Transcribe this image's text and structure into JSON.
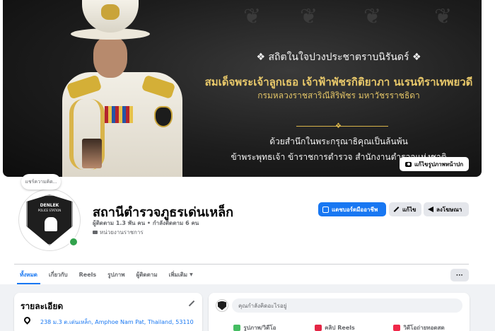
{
  "cover": {
    "line1": "❖ สถิตในใจปวงประชาตราบนิรันดร์ ❖",
    "line2": "สมเด็จพระเจ้าลูกเธอ เจ้าฟ้าพัชรกิติยาภา นเรนทิราเทพยวดี",
    "line3": "กรมหลวงราชสาริณีสิริพัชร มหาวัชรราชธิดา",
    "line4": "ด้วยสำนึกในพระกรุณาธิคุณเป็นล้นพ้น",
    "line5": "ข้าพระพุทธเจ้า ข้าราชการตำรวจ สำนักงานตำรวจแห่งชาติ",
    "edit_cover_label": "แก้ไขรูปภาพหน้าปก"
  },
  "profile": {
    "note_placeholder": "แชร์ความคิด...",
    "logo_title": "DENLEK",
    "logo_subtitle": "POLICE STATION",
    "name": "สถานีตำรวจภูธรเด่นเหล็ก",
    "followers": "ผู้ติดตาม 1.3 พัน คน • กำลังติดตาม 6 คน",
    "category": "หน่วยงานราชการ"
  },
  "actions": {
    "dashboard": "แดชบอร์ดมืออาชีพ",
    "edit": "แก้ไข",
    "advertise": "ลงโฆษณา",
    "more": "···"
  },
  "tabs": [
    {
      "label": "ทั้งหมด",
      "active": true
    },
    {
      "label": "เกี่ยวกับ",
      "active": false
    },
    {
      "label": "Reels",
      "active": false
    },
    {
      "label": "รูปภาพ",
      "active": false
    },
    {
      "label": "ผู้ติดตาม",
      "active": false
    },
    {
      "label": "เพิ่มเติม",
      "active": false
    }
  ],
  "details": {
    "title": "รายละเอียด",
    "address": "238 ม.3 ต.เด่นเหล็ก, Amphoe Nam Pat, Thailand, 53110"
  },
  "composer": {
    "placeholder": "คุณกำลังคิดอะไรอยู่",
    "actions": [
      "รูปภาพ/วิดีโอ",
      "คลิป Reels",
      "วิดีโอถ่ายทอดสด"
    ]
  },
  "colors": {
    "accent": "#1877f2",
    "online": "#31a24c",
    "photo_icon": "#45bd62",
    "reels_icon": "#e42645",
    "live_icon": "#f02849"
  }
}
